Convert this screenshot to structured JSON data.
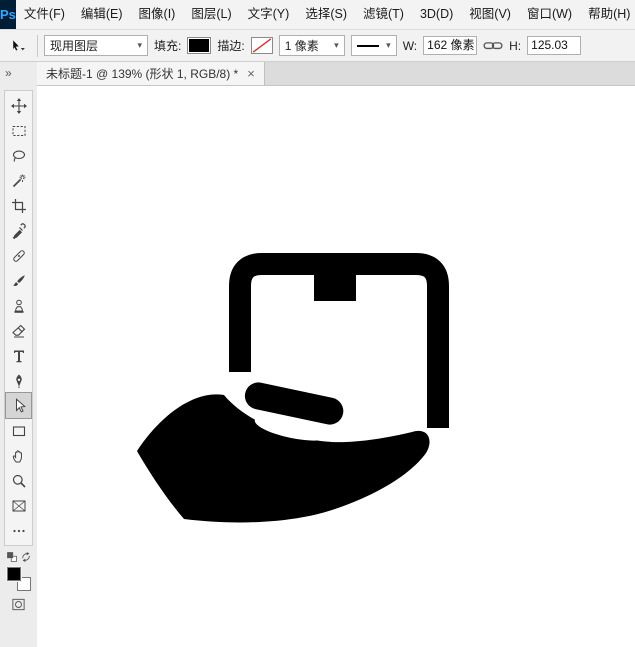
{
  "app": {
    "logo": "Ps",
    "logo_bg": "#001e36",
    "logo_color": "#31a8ff"
  },
  "menu": {
    "items": [
      {
        "id": "file",
        "label": "文件(F)"
      },
      {
        "id": "edit",
        "label": "编辑(E)"
      },
      {
        "id": "image",
        "label": "图像(I)"
      },
      {
        "id": "layer",
        "label": "图层(L)"
      },
      {
        "id": "type",
        "label": "文字(Y)"
      },
      {
        "id": "select",
        "label": "选择(S)"
      },
      {
        "id": "filter",
        "label": "滤镜(T)"
      },
      {
        "id": "3d",
        "label": "3D(D)"
      },
      {
        "id": "view",
        "label": "视图(V)"
      },
      {
        "id": "window",
        "label": "窗口(W)"
      },
      {
        "id": "help",
        "label": "帮助(H)"
      }
    ]
  },
  "options_bar": {
    "select_dropdown": {
      "value": "现用图层"
    },
    "fill": {
      "label": "填充:",
      "swatch_color": "#000000"
    },
    "stroke": {
      "label": "描边:",
      "swatch": "none",
      "width_value": "1 像素",
      "style": "solid-line"
    },
    "width_field": {
      "label": "W:",
      "value": "162 像素"
    },
    "link": {
      "icon": "link-dimensions"
    },
    "height_field": {
      "label": "H:",
      "value": "125.03"
    }
  },
  "document": {
    "tab_title": "未标题-1 @ 139% (形状 1, RGB/8) *",
    "close_glyph": "×",
    "canvas_shape": "hand-holding-box-icon",
    "shape_color": "#000000"
  },
  "toolbar": {
    "collapse_glyph": "»",
    "selected_tool": "path-selection-tool",
    "tools": [
      {
        "name": "move-tool"
      },
      {
        "name": "marquee-tool"
      },
      {
        "name": "lasso-tool"
      },
      {
        "name": "magic-wand-tool"
      },
      {
        "name": "crop-tool"
      },
      {
        "name": "eyedropper-tool"
      },
      {
        "name": "healing-brush-tool"
      },
      {
        "name": "brush-tool"
      },
      {
        "name": "clone-stamp-tool"
      },
      {
        "name": "eraser-tool"
      },
      {
        "name": "type-tool"
      },
      {
        "name": "pen-tool"
      },
      {
        "name": "path-selection-tool"
      },
      {
        "name": "rectangle-tool"
      },
      {
        "name": "hand-tool"
      },
      {
        "name": "zoom-tool"
      },
      {
        "name": "frame-tool"
      },
      {
        "name": "edit-toolbar-button"
      }
    ],
    "foreground_color": "#000000",
    "background_color": "#ffffff"
  }
}
